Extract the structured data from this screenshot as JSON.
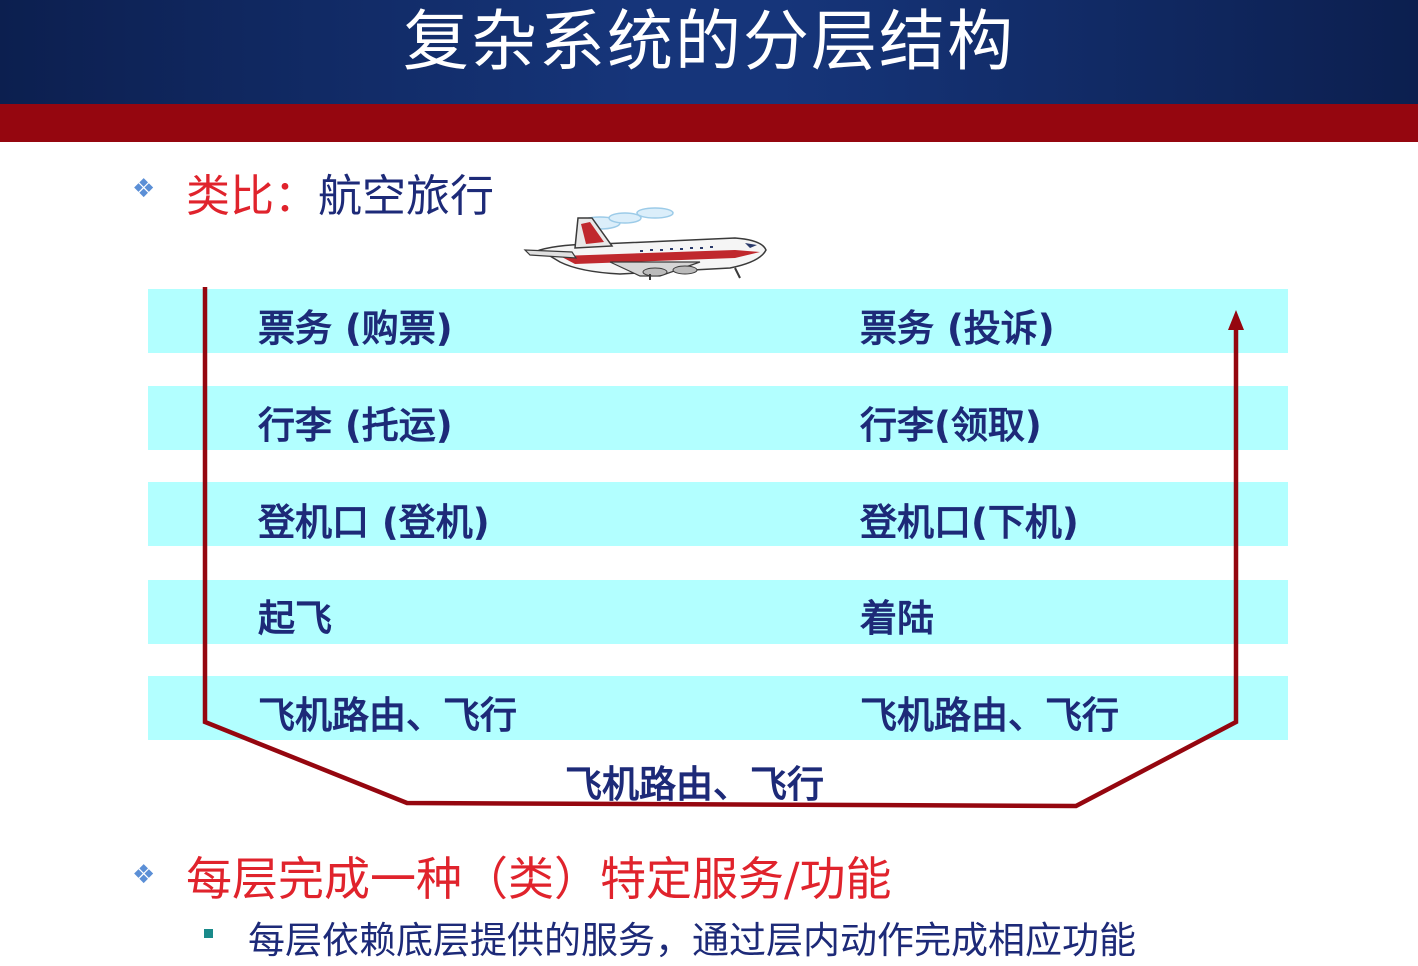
{
  "slide": {
    "title": "复杂系统的分层结构",
    "analogy_label": "类比：",
    "analogy_topic": "航空旅行",
    "layers": [
      {
        "left": "票务 (购票)",
        "right": "票务 (投诉)"
      },
      {
        "left": "行李 (托运)",
        "right": "行李(领取)"
      },
      {
        "left": "登机口 (登机)",
        "right": "登机口(下机)"
      },
      {
        "left": "起飞",
        "right": "着陆"
      },
      {
        "left": "飞机路由、飞行",
        "right": "飞机路由、飞行"
      }
    ],
    "bottom_route": "飞机路由、飞行",
    "point_heading": "每层完成一种（类）特定服务/功能",
    "point_sub": "每层依赖底层提供的服务，通过层内动作完成相应功能"
  },
  "colors": {
    "title_bg": "#16357a",
    "band": "#95060f",
    "layer_fill": "#b2ffff",
    "arrow": "#95060f",
    "heading_red": "#e0232c",
    "text_blue": "#1d2a78"
  },
  "icons": {
    "bullet": "diamond-bullet-icon",
    "airplane": "airplane-icon"
  }
}
